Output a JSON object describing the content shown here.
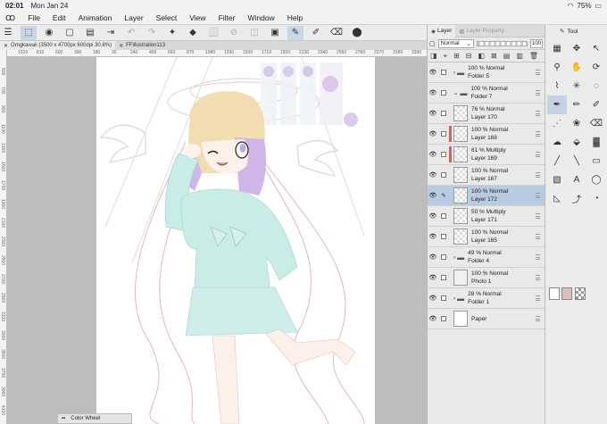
{
  "status": {
    "time": "02:01",
    "date": "Mon Jan 24",
    "battery": "75%"
  },
  "menu": [
    "File",
    "Edit",
    "Animation",
    "Layer",
    "Select",
    "View",
    "Filter",
    "Window",
    "Help"
  ],
  "tabs": [
    {
      "label": "Omgkawaii (3500 x 4700px 600dpi 30.8%)"
    },
    {
      "label": "FFillustration113"
    }
  ],
  "ruler_top": [
    "1020",
    "810",
    "600",
    "390",
    "180",
    "30",
    "240",
    "450",
    "660",
    "870",
    "1080",
    "1290",
    "1500",
    "1710",
    "1920",
    "2130",
    "2340",
    "2550",
    "2760",
    "2970",
    "3180",
    "3390"
  ],
  "ruler_left": [
    "500",
    "700",
    "900",
    "1100",
    "1300",
    "1500",
    "1700",
    "1900",
    "2100",
    "2300",
    "2500",
    "2700",
    "2900",
    "3100",
    "3300",
    "3500",
    "3700",
    "3900",
    "4100"
  ],
  "color_wheel": {
    "label": "Color Wheel"
  },
  "layer_panel": {
    "tab_layer": "Layer",
    "tab_property": "Layer Property",
    "blend_mode": "Normal",
    "opacity_value": "100",
    "layers": [
      {
        "line1": "100 % Normal",
        "line2": "Folder 5",
        "type": "folder",
        "collapsed": true,
        "selected": false
      },
      {
        "line1": "100 % Normal",
        "line2": "Folder 7",
        "type": "folder",
        "collapsed": false,
        "selected": false
      },
      {
        "line1": "76 % Normal",
        "line2": "Layer 170",
        "type": "raster",
        "color": "",
        "selected": false
      },
      {
        "line1": "100 % Normal",
        "line2": "Layer 168",
        "type": "raster",
        "color": "#d46060",
        "selected": false
      },
      {
        "line1": "61 % Multiply",
        "line2": "Layer 169",
        "type": "raster",
        "color": "#d46060",
        "selected": false
      },
      {
        "line1": "100 % Normal",
        "line2": "Layer 167",
        "type": "raster",
        "color": "",
        "selected": false
      },
      {
        "line1": "100 % Normal",
        "line2": "Layer 172",
        "type": "raster",
        "color": "",
        "selected": true
      },
      {
        "line1": "50 % Multiply",
        "line2": "Layer 171",
        "type": "raster",
        "color": "",
        "selected": false
      },
      {
        "line1": "100 % Normal",
        "line2": "Layer 165",
        "type": "raster",
        "color": "",
        "selected": false
      },
      {
        "line1": "49 % Normal",
        "line2": "Folder 4",
        "type": "folder",
        "collapsed": true,
        "selected": false
      },
      {
        "line1": "100 % Normal",
        "line2": "Photo 1",
        "type": "photo",
        "selected": false
      },
      {
        "line1": "28 % Normal",
        "line2": "Folder 1",
        "type": "folder",
        "collapsed": true,
        "selected": false
      },
      {
        "line1": "",
        "line2": "Paper",
        "type": "paper",
        "selected": false
      }
    ]
  },
  "tool_panel": {
    "title": "Tool"
  },
  "colors": {
    "accent": "#b9cbe0",
    "paper": "#ffffff",
    "bg": "#bdbdbd",
    "main_color": "#ffffff",
    "sub_color": "#d9c0c0"
  }
}
